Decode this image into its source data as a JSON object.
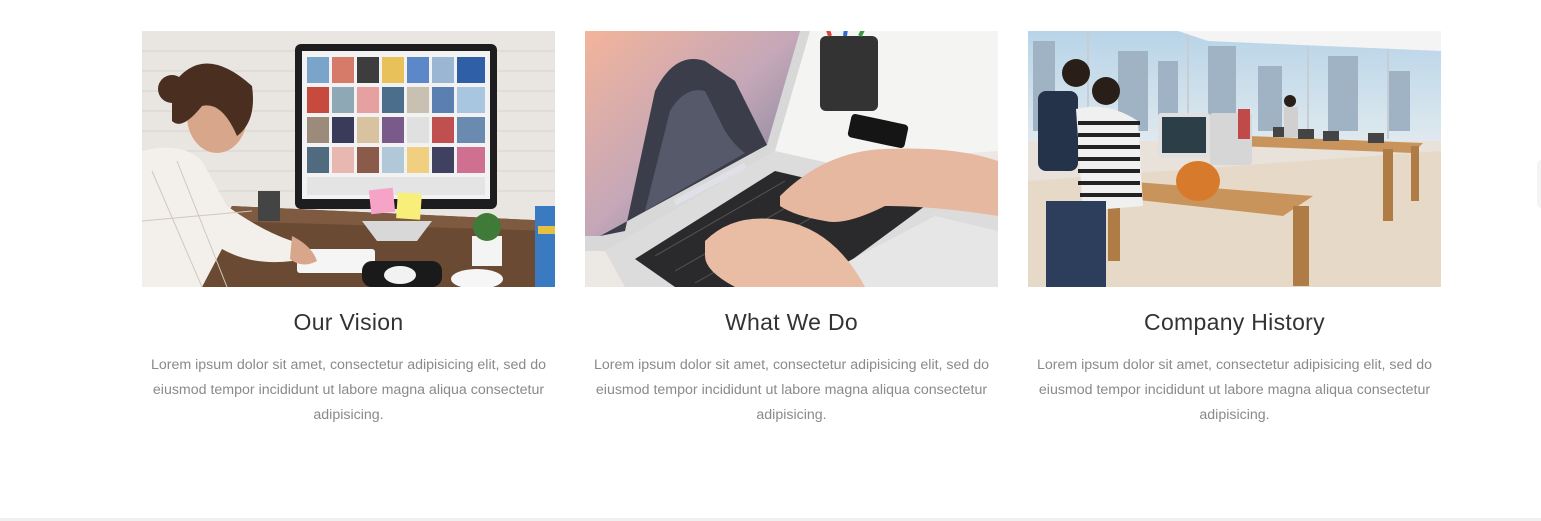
{
  "cards": [
    {
      "title": "Our Vision",
      "text": "Lorem ipsum dolor sit amet, consectetur adipisicing elit, sed do eiusmod tempor incididunt ut labore magna aliqua consectetur adipisicing.",
      "image_icon": "photo-woman-at-desktop-icon"
    },
    {
      "title": "What We Do",
      "text": "Lorem ipsum dolor sit amet, consectetur adipisicing elit, sed do eiusmod tempor incididunt ut labore magna aliqua consectetur adipisicing.",
      "image_icon": "photo-typing-on-laptop-icon"
    },
    {
      "title": "Company History",
      "text": "Lorem ipsum dolor sit amet, consectetur adipisicing elit, sed do eiusmod tempor incididunt ut labore magna aliqua consectetur adipisicing.",
      "image_icon": "photo-store-showroom-icon"
    }
  ],
  "colors": {
    "title": "#333333",
    "body_text": "#8a8a8a",
    "background": "#ffffff"
  }
}
